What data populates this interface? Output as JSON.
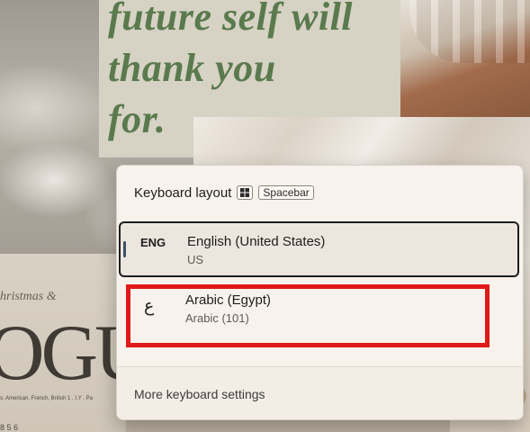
{
  "wallpaper": {
    "quote_lines": [
      "future self will",
      "thank you",
      "for."
    ],
    "magazine_word": "OGU",
    "magazine_script": "hristmas &",
    "magazine_small": "s: American, French, British",
    "magazine_small2": "1 . I.Y . Pa",
    "magazine_footer": "8 5 6"
  },
  "flyout": {
    "title": "Keyboard layout",
    "shortcut_win_icon": "windows-logo-icon",
    "shortcut_key": "Spacebar",
    "layouts": [
      {
        "code": "ENG",
        "name": "English (United States)",
        "sub": "US",
        "selected": true
      },
      {
        "code": "ع",
        "name": "Arabic (Egypt)",
        "sub": "Arabic (101)",
        "selected": false
      }
    ],
    "footer_link": "More keyboard settings"
  },
  "colors": {
    "panel_bg": "#f7f2ec",
    "selected_border": "#1d1d1d",
    "highlight": "#e01818",
    "quote_green": "#5a7a4e"
  }
}
